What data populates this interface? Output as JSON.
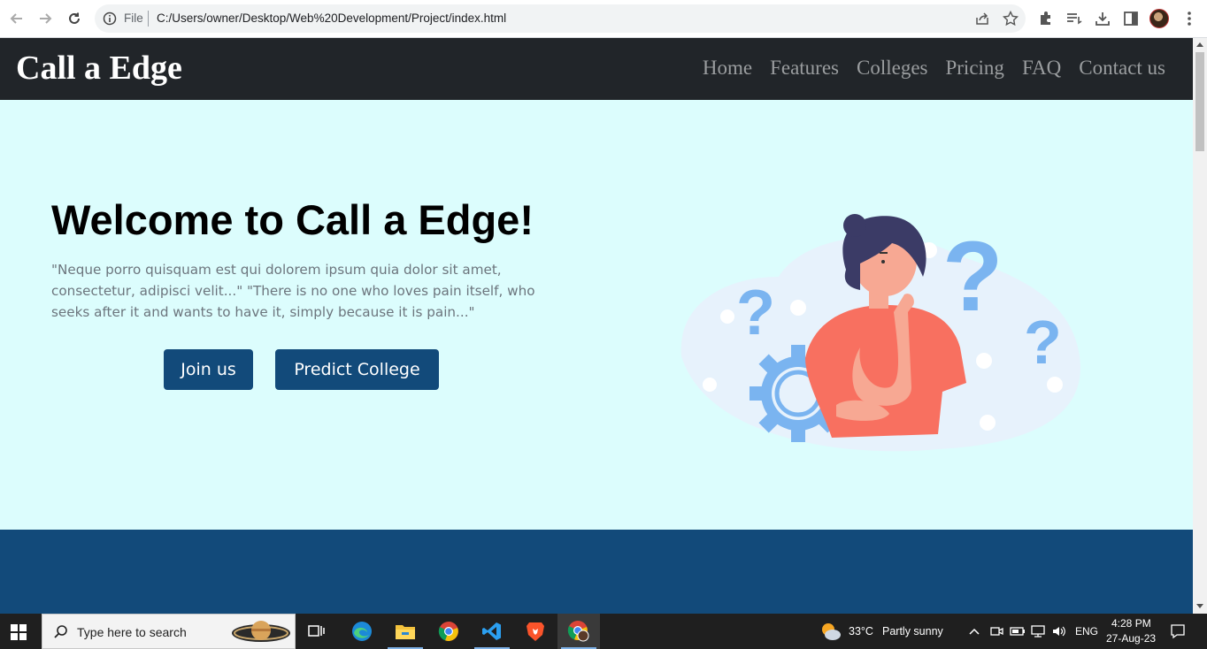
{
  "browser": {
    "file_label": "File",
    "url": "C:/Users/owner/Desktop/Web%20Development/Project/index.html"
  },
  "navbar": {
    "brand": "Call a Edge",
    "links": [
      "Home",
      "Features",
      "Colleges",
      "Pricing",
      "FAQ",
      "Contact us"
    ]
  },
  "hero": {
    "title": "Welcome to Call a Edge!",
    "text": "\"Neque porro quisquam est qui dolorem ipsum quia dolor sit amet, consectetur, adipisci velit...\" \"There is no one who loves pain itself, who seeks after it and wants to have it, simply because it is pain...\"",
    "join_button": "Join us",
    "predict_button": "Predict College"
  },
  "taskbar": {
    "search_placeholder": "Type here to search",
    "weather_temp": "33°C",
    "weather_desc": "Partly sunny",
    "language": "ENG",
    "time": "4:28 PM",
    "date": "27-Aug-23"
  },
  "colors": {
    "navbar_bg": "#212529",
    "hero_bg": "#dcfdfd",
    "accent": "#124a7a",
    "nav_link": "#9a9d9f"
  }
}
